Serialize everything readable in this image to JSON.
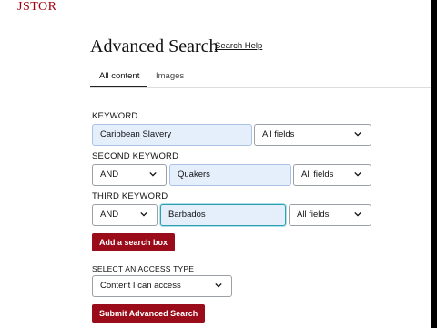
{
  "header": {
    "logo": "JSTOR"
  },
  "page": {
    "title": "Advanced Search",
    "help_link": "Search Help"
  },
  "tabs": [
    {
      "label": "All content",
      "active": true
    },
    {
      "label": "Images",
      "active": false
    }
  ],
  "keyword1": {
    "label": "KEYWORD",
    "value": "Caribbean Slavery",
    "field": "All fields"
  },
  "keyword2": {
    "label": "SECOND KEYWORD",
    "operator": "AND",
    "value": "Quakers",
    "field": "All fields"
  },
  "keyword3": {
    "label": "THIRD KEYWORD",
    "operator": "AND",
    "value": "Barbados",
    "field": "All fields"
  },
  "add_box_button": "Add a search box",
  "access": {
    "label": "SELECT AN ACCESS TYPE",
    "value": "Content I can access"
  },
  "submit_button": "Submit Advanced Search",
  "colors": {
    "brand": "#9b0c1a",
    "input_highlight": "#e5effc",
    "focus_border": "#2e9fb0"
  }
}
